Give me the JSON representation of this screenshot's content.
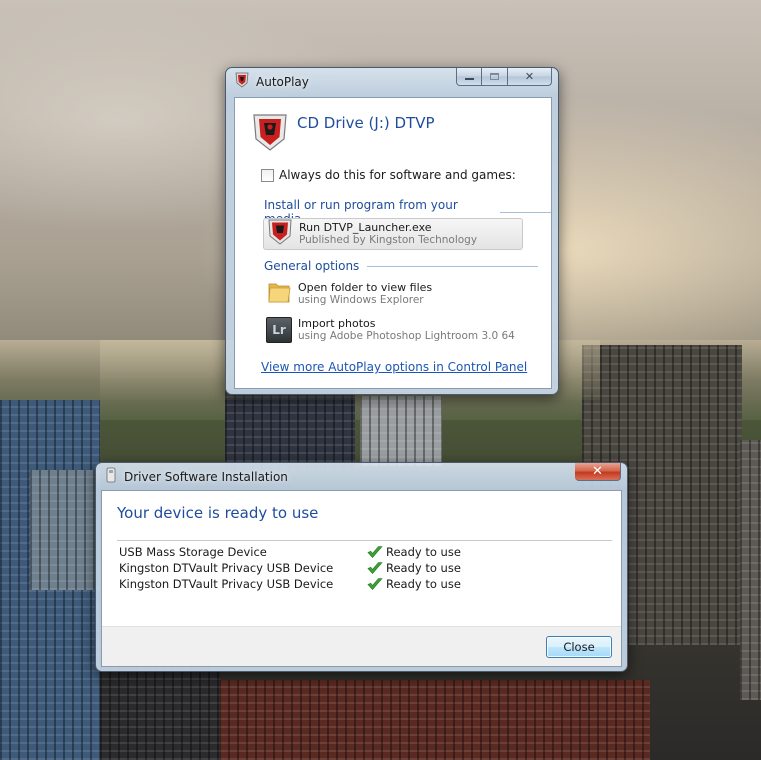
{
  "autoplay": {
    "title": "AutoPlay",
    "drive_label": "CD Drive (J:) DTVP",
    "always_checkbox_label": "Always do this for software and games:",
    "install_section_title": "Install or run program from your media",
    "run_option": {
      "label": "Run DTVP_Launcher.exe",
      "sublabel": "Published by Kingston Technology"
    },
    "general_section_title": "General options",
    "open_folder_option": {
      "label": "Open folder to view files",
      "sublabel": "using Windows Explorer"
    },
    "import_photos_option": {
      "label": "Import photos",
      "sublabel": "using Adobe Photoshop Lightroom 3.0 64"
    },
    "lightroom_icon_text": "Lr",
    "control_panel_link": "View more AutoPlay options in Control Panel"
  },
  "driver_install": {
    "title": "Driver Software Installation",
    "heading": "Your device is ready to use",
    "devices": [
      {
        "name": "USB Mass Storage Device",
        "status": "Ready to use"
      },
      {
        "name": "Kingston DTVault Privacy USB Device",
        "status": "Ready to use"
      },
      {
        "name": "Kingston DTVault Privacy USB Device",
        "status": "Ready to use"
      }
    ],
    "close_button": "Close",
    "close_glyph": "✕"
  },
  "colors": {
    "heading_blue": "#1f4d9c",
    "link_blue": "#1c56b5",
    "kingston_red": "#c8201e",
    "check_green": "#3aa335"
  }
}
